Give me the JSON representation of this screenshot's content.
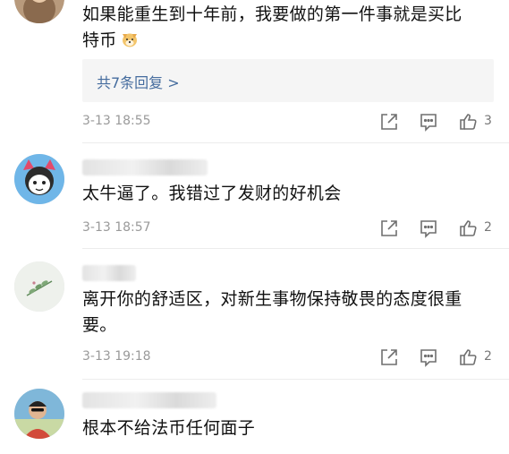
{
  "comments": [
    {
      "text_line1": "如果能重生到十年前，我要做的第一件事就是买比",
      "text_line2": "特币",
      "emoji_icon": "dog-face-emoji-icon",
      "replies_label": "共7条回复 >",
      "time": "3-13 18:55",
      "likes": "3"
    },
    {
      "text_line1": "太牛逼了。我错过了发财的好机会",
      "time": "3-13 18:57",
      "likes": "2"
    },
    {
      "text_line1": "离开你的舒适区，对新生事物保持敬畏的态度很重",
      "text_line2": "要。",
      "time": "3-13 19:18",
      "likes": "2"
    },
    {
      "text_line1": "根本不给法币任何面子"
    }
  ],
  "colors": {
    "reply_link": "#456c9e",
    "time_gray": "#9a9a9a",
    "icon_gray": "#6f6f6f",
    "reply_box_bg": "#f5f5f5"
  }
}
